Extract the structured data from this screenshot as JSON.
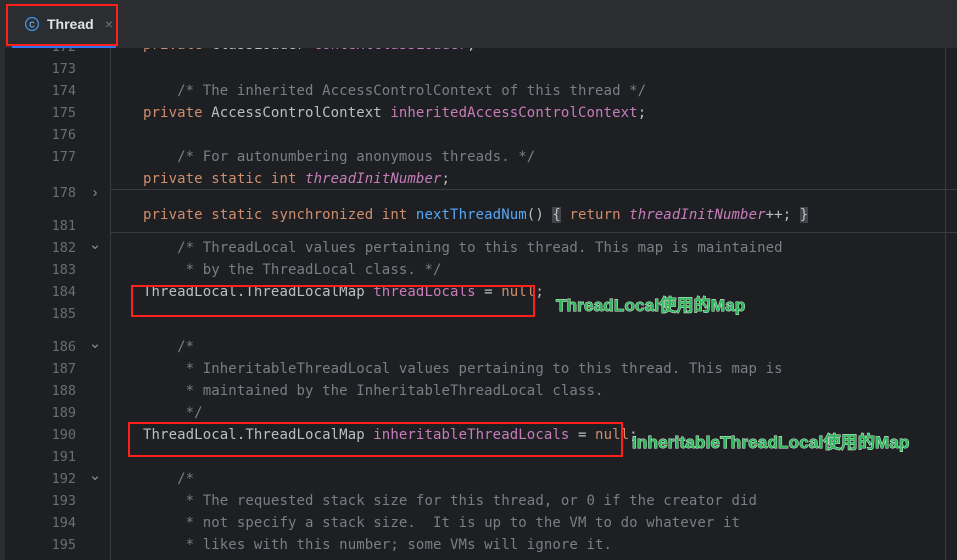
{
  "window": {
    "background": "#1e1f22",
    "tabbar_background": "#2b2d30"
  },
  "tab": {
    "icon": "java-class-icon",
    "label": "Thread",
    "close_label": "×",
    "active_underline_color": "#3574f0"
  },
  "editor": {
    "gutter": {
      "lines": [
        {
          "number": "172",
          "fold": ""
        },
        {
          "number": "173",
          "fold": ""
        },
        {
          "number": "174",
          "fold": ""
        },
        {
          "number": "175",
          "fold": ""
        },
        {
          "number": "176",
          "fold": ""
        },
        {
          "number": "177",
          "fold": ""
        },
        {
          "number": "178",
          "fold": "right"
        },
        {
          "number": "181",
          "fold": ""
        },
        {
          "number": "182",
          "fold": "down"
        },
        {
          "number": "183",
          "fold": ""
        },
        {
          "number": "184",
          "fold": ""
        },
        {
          "number": "185",
          "fold": ""
        },
        {
          "number": "186",
          "fold": "down"
        },
        {
          "number": "187",
          "fold": ""
        },
        {
          "number": "188",
          "fold": ""
        },
        {
          "number": "189",
          "fold": ""
        },
        {
          "number": "190",
          "fold": ""
        },
        {
          "number": "191",
          "fold": ""
        },
        {
          "number": "192",
          "fold": "down"
        },
        {
          "number": "193",
          "fold": ""
        },
        {
          "number": "194",
          "fold": ""
        },
        {
          "number": "195",
          "fold": ""
        }
      ]
    },
    "code": {
      "line_171_clipped": "    private ClassLoader contextClassLoader;",
      "line_173": "    /* The inherited AccessControlContext of this thread */",
      "line_174": "    private AccessControlContext inheritedAccessControlContext;",
      "line_176": "    /* For autonumbering anonymous threads. */",
      "line_177": "    private static int threadInitNumber;",
      "line_178": "    private static synchronized int nextThreadNum() { return threadInitNumber++; }",
      "line_182": "    /* ThreadLocal values pertaining to this thread. This map is maintained",
      "line_183": "     * by the ThreadLocal class. */",
      "line_184": "    ThreadLocal.ThreadLocalMap threadLocals = null;",
      "line_186": "    /*",
      "line_187": "     * InheritableThreadLocal values pertaining to this thread. This map is",
      "line_188": "     * maintained by the InheritableThreadLocal class.",
      "line_189": "     */",
      "line_190": "    ThreadLocal.ThreadLocalMap inheritableThreadLocals = null;",
      "line_192": "    /*",
      "line_193": "     * The requested stack size for this thread, or 0 if the creator did",
      "line_194": "     * not specify a stack size.  It is up to the VM to do whatever it",
      "line_195": "     * likes with this number; some VMs will ignore it."
    },
    "tokens": {
      "kw_private": "private",
      "kw_static": "static",
      "kw_synchronized": "synchronized",
      "kw_int": "int",
      "kw_return": "return",
      "kw_null": "null",
      "type_AccessControlContext": "AccessControlContext",
      "field_inheritedAccessControlContext": "inheritedAccessControlContext",
      "field_threadInitNumber": "threadInitNumber",
      "method_nextThreadNum": "nextThreadNum",
      "type_ThreadLocalMap": "ThreadLocal.ThreadLocalMap",
      "field_threadLocals": "threadLocals",
      "field_inheritableThreadLocals": "inheritableThreadLocals"
    },
    "colors": {
      "keyword": "#cf8e6d",
      "type": "#bcbec4",
      "field": "#c77dbb",
      "method": "#56a8f5",
      "comment": "#7a7e85",
      "line_number": "#6a6e74"
    }
  },
  "annotations": {
    "box_color": "#ff2119",
    "label_color": "#2eb85c",
    "label_threadlocal_map": "ThreadLocal使用的Map",
    "label_inheritable_threadlocal_map": "InheritableThreadLocal使用的Map"
  }
}
